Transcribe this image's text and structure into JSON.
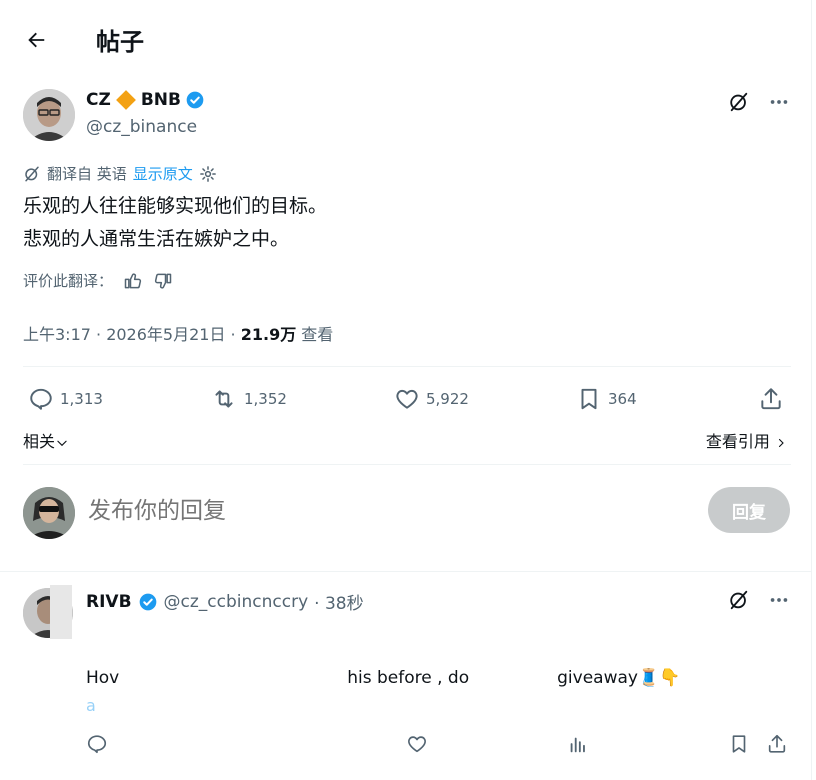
{
  "header": {
    "title": "帖子"
  },
  "post": {
    "author_name": "CZ",
    "author_name_suffix": "BNB",
    "author_handle": "@cz_binance",
    "translation": {
      "prefix": "翻译自 英语",
      "show_original": "显示原文"
    },
    "text_line1": "乐观的人往往能够实现他们的目标。",
    "text_line2": "悲观的人通常生活在嫉妒之中。",
    "rate_label": "评价此翻译：",
    "timestamp": "上午3:17 · 2026年5月21日 · ",
    "views_count": "21.9万",
    "views_label": " 查看",
    "stats": {
      "replies": "1,313",
      "reposts": "1,352",
      "likes": "5,922",
      "bookmarks": "364"
    },
    "related_label": "相关",
    "view_quotes_label": "查看引用"
  },
  "reply_box": {
    "placeholder": "发布你的回复",
    "button_label": "回复"
  },
  "reply": {
    "name": "RIVB",
    "handle": "@cz_ccbincnccry",
    "time": "· 38秒",
    "text_part1": "Hov",
    "text_part2": "his before , do",
    "text_part3": "giveaway",
    "emoji": "🧵👇",
    "link_text": "a"
  },
  "colors": {
    "accent": "#1d9bf0",
    "muted": "#536471",
    "text": "#0f1419",
    "divider": "#eff3f4",
    "diamond": "#f3a113"
  }
}
